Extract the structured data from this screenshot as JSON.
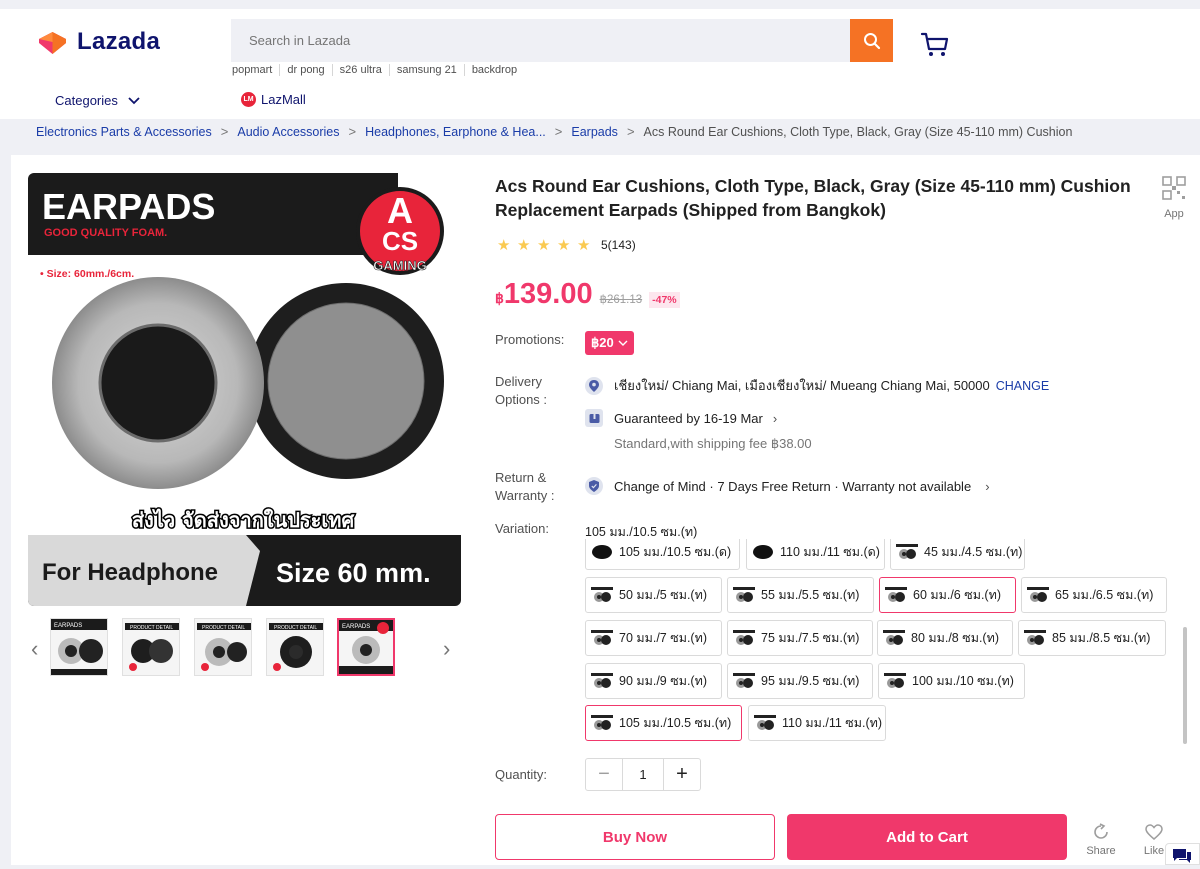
{
  "header": {
    "logo_text": "Lazada",
    "search_placeholder": "Search in Lazada",
    "suggestions": [
      "popmart",
      "dr pong",
      "s26 ultra",
      "samsung 21",
      "backdrop"
    ],
    "categories_label": "Categories",
    "lazmall_badge": "LM",
    "lazmall_label": "LazMall"
  },
  "breadcrumb": [
    "Electronics Parts & Accessories",
    "Audio Accessories",
    "Headphones, Earphone & Hea...",
    "Earpads",
    "Acs Round Ear Cushions, Cloth Type, Black, Gray (Size 45-110 mm) Cushion"
  ],
  "breadcrumb_sep": ">",
  "gallery": {
    "hero_title": "EARPADS",
    "hero_subtitle": "GOOD QUALITY FOAM.",
    "hero_brand_a": "A",
    "hero_brand_cs": "CS",
    "hero_brand_gaming": "GAMING",
    "hero_size_note": "• Size: 60mm./6cm.",
    "hero_thai": "ส่งไว จัดส่งจากในประเทศ",
    "hero_for": "For Headphone",
    "hero_size": "Size 60 mm.",
    "thumb_labels": [
      "EARPADS",
      "PRODUCT DETAIL",
      "PRODUCT DETAIL",
      "PRODUCT DETAIL",
      "EARPADS"
    ],
    "prev": "‹",
    "next": "›"
  },
  "product": {
    "title": "Acs Round Ear Cushions, Cloth Type, Black, Gray (Size 45-110 mm) Cushion Replacement Earpads (Shipped from Bangkok)",
    "app_label": "App",
    "rating": 5,
    "rating_text": "5(143)",
    "currency": "฿",
    "price": "139.00",
    "original_price": "฿261.13",
    "discount": "-47%"
  },
  "promotions": {
    "label": "Promotions:",
    "pill": "฿20"
  },
  "delivery": {
    "label": "Delivery Options :",
    "address": "เชียงใหม่/ Chiang Mai, เมืองเชียงใหม่/ Mueang Chiang Mai, 50000",
    "change": "CHANGE",
    "guarantee": "Guaranteed by 16-19 Mar",
    "fee": "Standard,with shipping fee ฿38.00"
  },
  "return": {
    "label": "Return & Warranty :",
    "text": "Change of Mind · 7 Days Free Return · Warranty not available"
  },
  "variation": {
    "label": "Variation:",
    "selected": "105 มม./10.5 ซม.(ท)",
    "options": [
      {
        "label": "105 มม./10.5 ซม.(ด)",
        "selected": false
      },
      {
        "label": "110 มม./11 ซม.(ด)",
        "selected": false
      },
      {
        "label": "45 มม./4.5 ซม.(ท)",
        "selected": false
      },
      {
        "label": "50 มม./5 ซม.(ท)",
        "selected": false
      },
      {
        "label": "55 มม./5.5 ซม.(ท)",
        "selected": false
      },
      {
        "label": "60 มม./6 ซม.(ท)",
        "selected": true
      },
      {
        "label": "65 มม./6.5 ซม.(ท)",
        "selected": false
      },
      {
        "label": "70 มม./7 ซม.(ท)",
        "selected": false
      },
      {
        "label": "75 มม./7.5 ซม.(ท)",
        "selected": false
      },
      {
        "label": "80 มม./8 ซม.(ท)",
        "selected": false
      },
      {
        "label": "85 มม./8.5 ซม.(ท)",
        "selected": false
      },
      {
        "label": "90 มม./9 ซม.(ท)",
        "selected": false
      },
      {
        "label": "95 มม./9.5 ซม.(ท)",
        "selected": false
      },
      {
        "label": "100 มม./10 ซม.(ท)",
        "selected": false
      },
      {
        "label": "105 มม./10.5 ซม.(ท)",
        "selected": true
      },
      {
        "label": "110 มม./11 ซม.(ท)",
        "selected": false
      }
    ]
  },
  "quantity": {
    "label": "Quantity:",
    "value": "1",
    "minus": "−",
    "plus": "+"
  },
  "actions": {
    "buy_now": "Buy Now",
    "add_to_cart": "Add to Cart",
    "share": "Share",
    "like": "Like"
  },
  "colors": {
    "brand_pink": "#f0386b",
    "search_orange": "#f57224",
    "link_blue": "#1a3ca8",
    "star": "#faca51"
  }
}
